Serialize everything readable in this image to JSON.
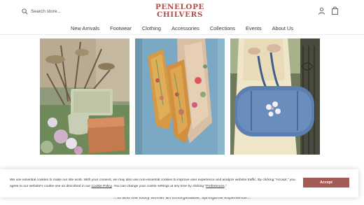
{
  "header": {
    "search_placeholder": "Search store...",
    "logo_line1": "PENELOPE",
    "logo_line2": "CHILVERS"
  },
  "nav": {
    "items": [
      "New Arrivals",
      "Footwear",
      "Clothing",
      "Accessories",
      "Collections",
      "Events",
      "About Us"
    ]
  },
  "icons": {
    "search": "search-icon",
    "account": "account-icon",
    "bag": "shopping-bag-icon"
  },
  "background_text": "...to and the lucky winner an unforgettable, springtime experience...",
  "cookie": {
    "text_part1": "We use essential cookies to make our site work. With your consent, we may also use non-essential cookies to improve user experience and analyze website traffic. By clicking \"Accept,\" you agree to our website's cookie use as described in our ",
    "cookie_policy_link": "Cookie Policy",
    "text_part2": ". You can change your cookie settings at any time by clicking \"",
    "preferences_link": "Preferences",
    "text_part3": ".\"",
    "accept_label": "Accept"
  },
  "colors": {
    "brand": "#b24d44",
    "accept_button": "#a45a55"
  }
}
